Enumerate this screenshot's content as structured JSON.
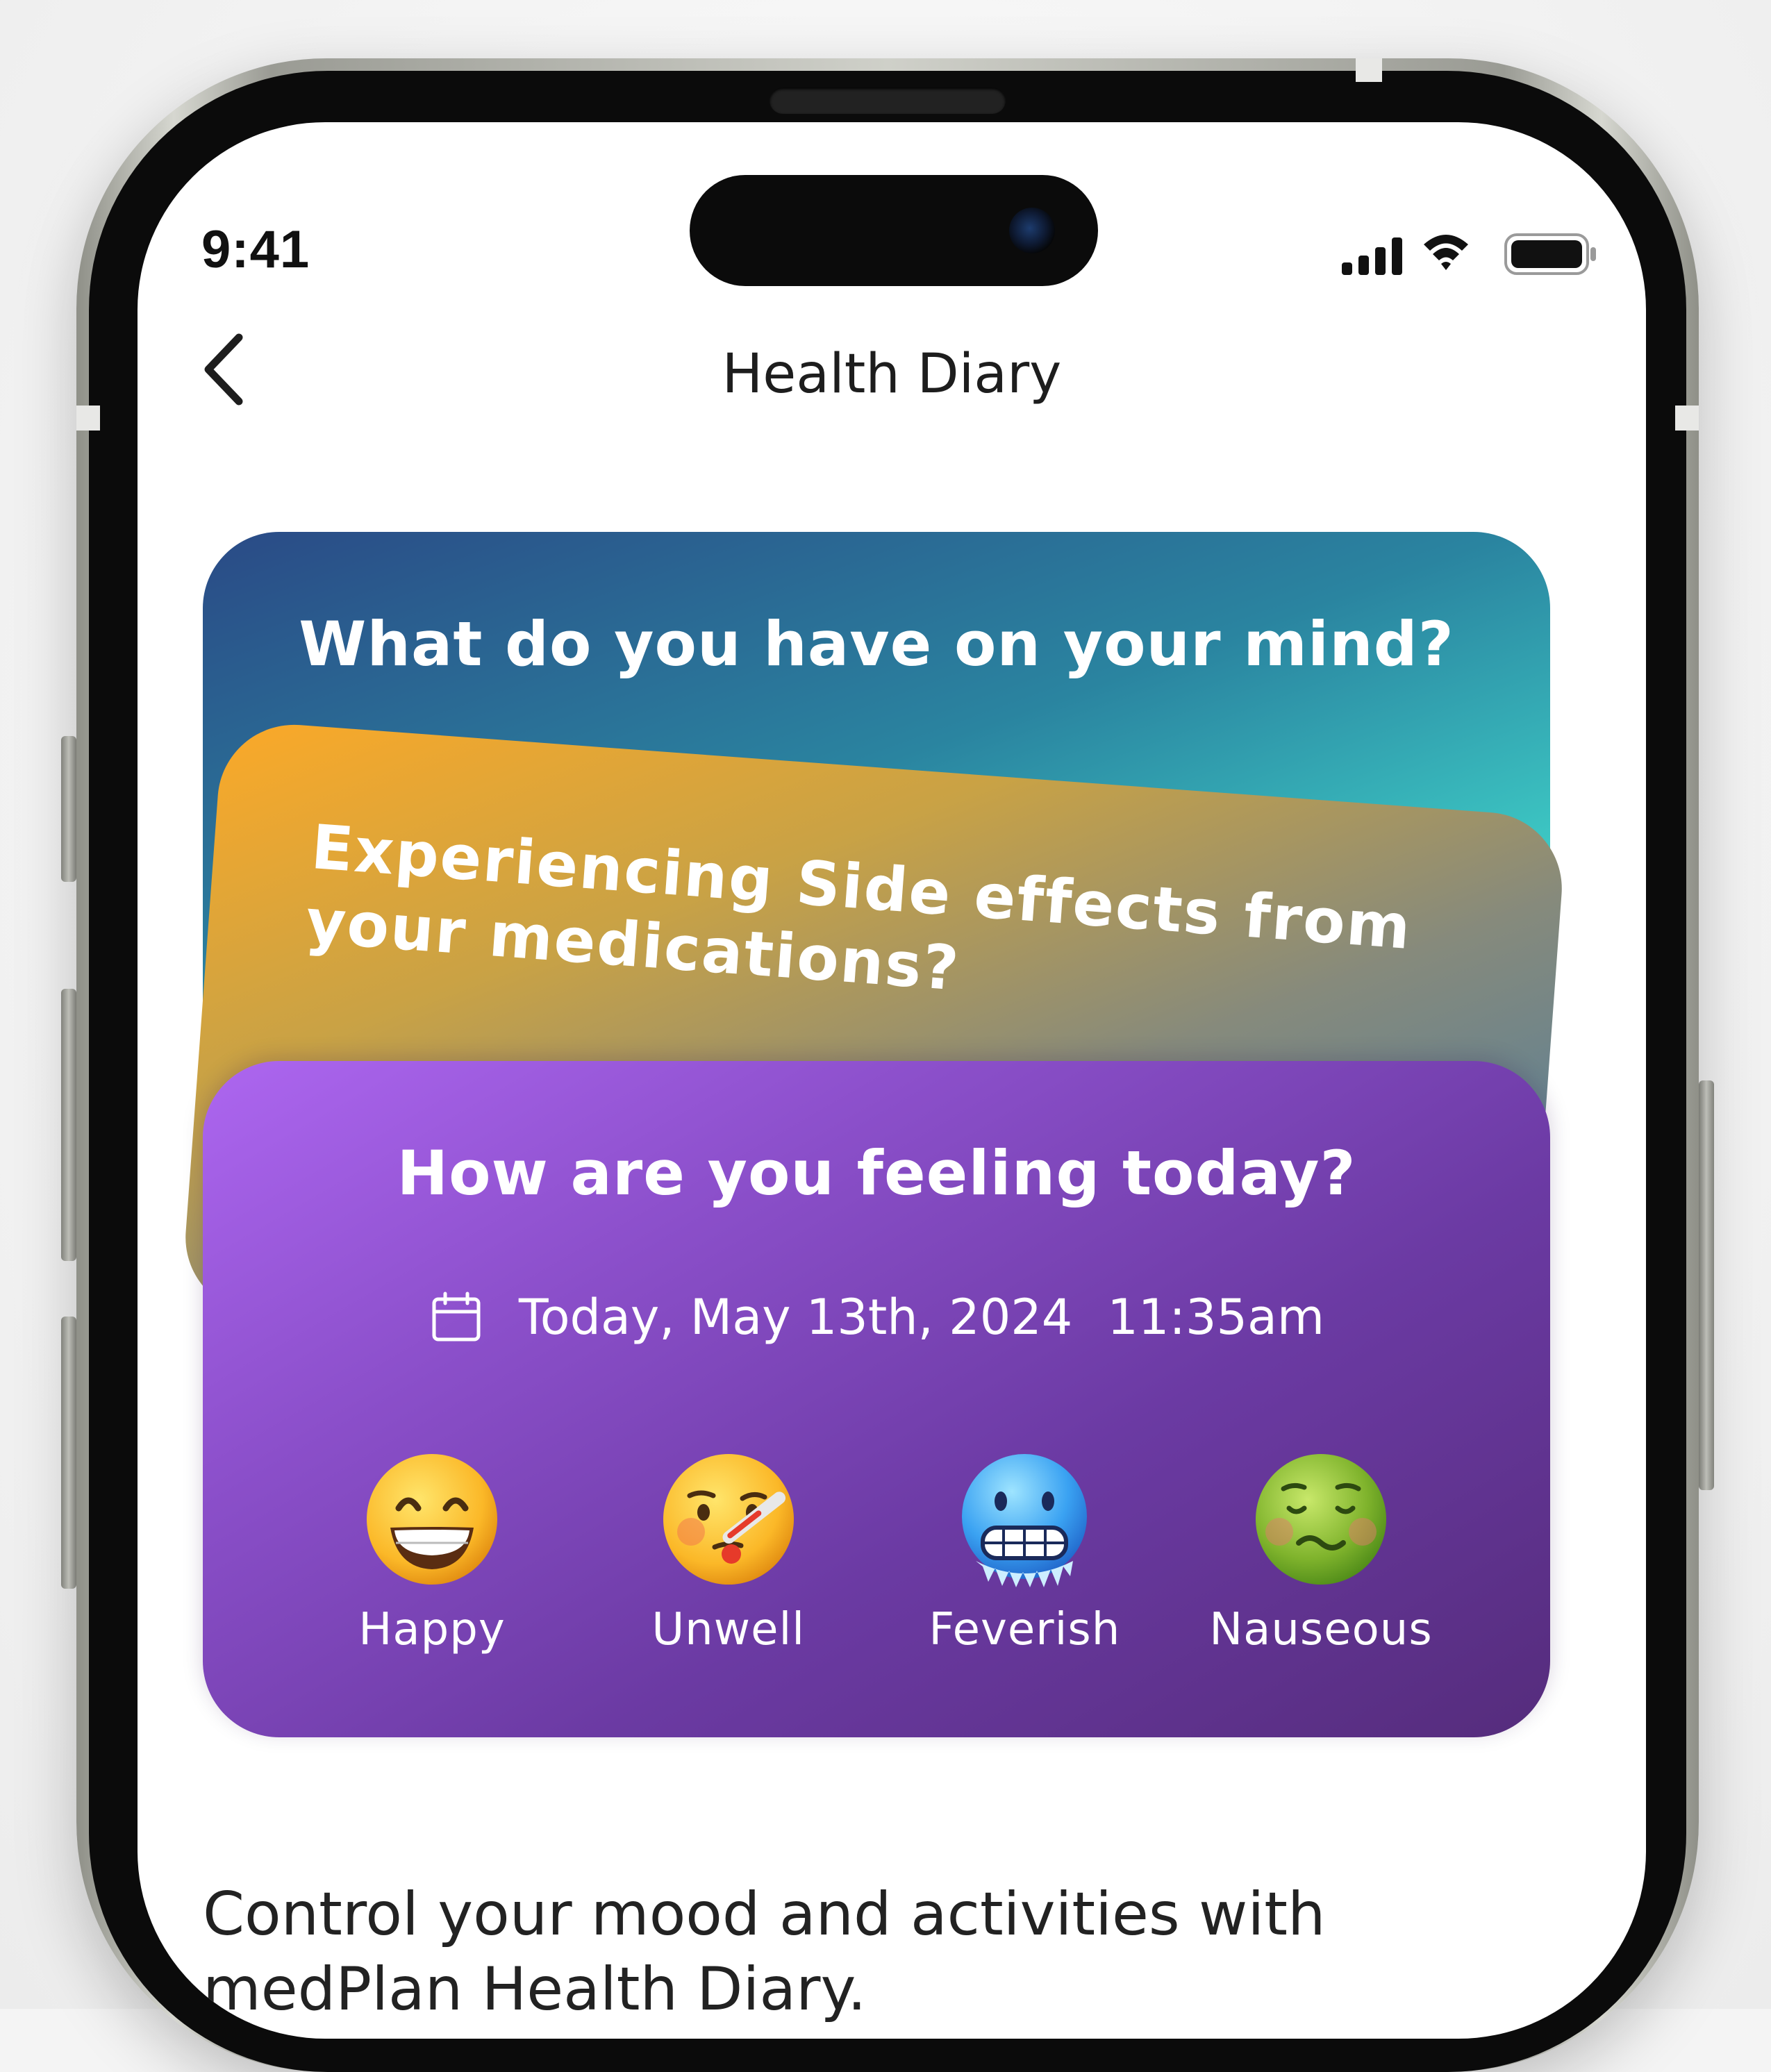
{
  "status_bar": {
    "time": "9:41",
    "icons": [
      "cellular-signal-icon",
      "wifi-icon",
      "battery-icon"
    ]
  },
  "header": {
    "back_icon": "chevron-left-icon",
    "title": "Health Diary"
  },
  "cards": {
    "back": {
      "question": "What do you have on your mind?"
    },
    "middle": {
      "question_line1": "Experiencing Side effects from",
      "question_line2": "your medications?"
    },
    "front": {
      "question": "How are you feeling today?",
      "date": "Today, May 13th, 2024",
      "time": "11:35am",
      "date_icon": "calendar-icon",
      "moods": [
        {
          "label": "Happy",
          "icon": "grinning-face-icon"
        },
        {
          "label": "Unwell",
          "icon": "face-with-thermometer-icon"
        },
        {
          "label": "Feverish",
          "icon": "cold-face-icon"
        },
        {
          "label": "Nauseous",
          "icon": "nauseated-face-icon"
        }
      ]
    }
  },
  "description": {
    "line1": "Control your mood and activities with",
    "line2": "medPlan Health Diary."
  },
  "colors": {
    "card_back_start": "#2a4a86",
    "card_back_end": "#46fbe0",
    "card_mid_start": "#fba928",
    "card_mid_end": "#3d78a8",
    "card_front_start": "#ad66f0",
    "card_front_end": "#552c7c"
  }
}
